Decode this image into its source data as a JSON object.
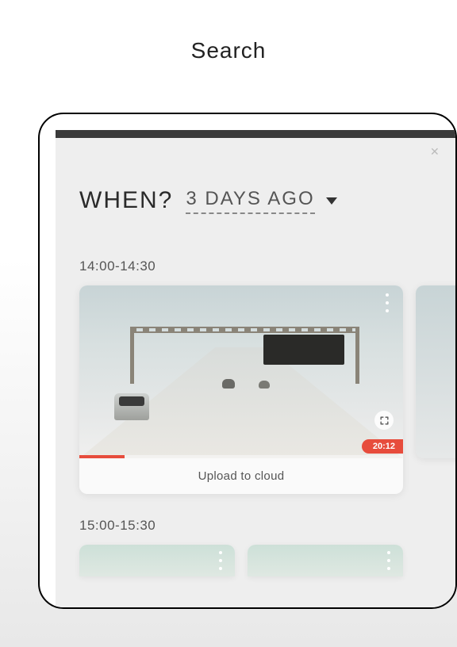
{
  "page": {
    "title": "Search"
  },
  "filter": {
    "label": "WHEN?",
    "value": "3 DAYS AGO"
  },
  "segments": [
    {
      "time_range": "14:00-14:30",
      "cards": [
        {
          "duration": "20:12",
          "caption": "Upload to cloud"
        }
      ]
    },
    {
      "time_range": "15:00-15:30",
      "cards": []
    }
  ]
}
